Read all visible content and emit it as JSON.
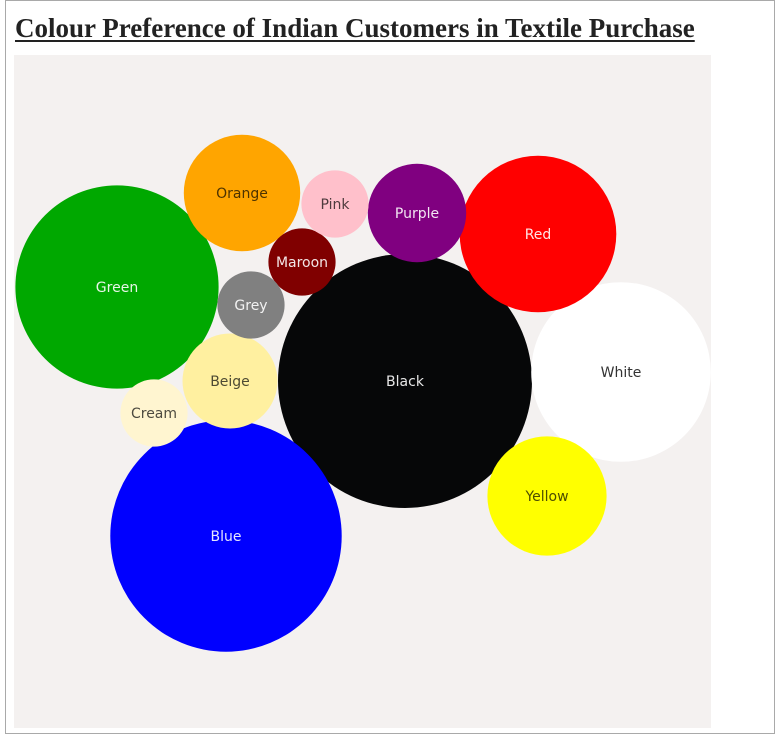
{
  "title": "Colour Preference of Indian Customers in Textile Purchase",
  "chart_data": {
    "type": "bubble",
    "title": "Colour Preference of Indian Customers in Textile Purchase",
    "bubbles": [
      {
        "label": "Black",
        "value": 100,
        "color": "#060708",
        "text_color": "#e6e6e6"
      },
      {
        "label": "Blue",
        "value": 83,
        "color": "#0000ff",
        "text_color": "#e6e6ff"
      },
      {
        "label": "Green",
        "value": 64,
        "color": "#00a800",
        "text_color": "#e8f5e8"
      },
      {
        "label": "White",
        "value": 50,
        "color": "#ffffff",
        "text_color": "#333333"
      },
      {
        "label": "Red",
        "value": 38,
        "color": "#ff0000",
        "text_color": "#ffe6e6"
      },
      {
        "label": "Orange",
        "value": 21,
        "color": "#ffa500",
        "text_color": "#4d3300"
      },
      {
        "label": "Yellow",
        "value": 22,
        "color": "#ffff00",
        "text_color": "#4d4d00"
      },
      {
        "label": "Purple",
        "value": 15,
        "color": "#800080",
        "text_color": "#f2e6f2"
      },
      {
        "label": "Beige",
        "value": 14,
        "color": "#fff0a0",
        "text_color": "#4d4a33"
      },
      {
        "label": "Maroon",
        "value": 7,
        "color": "#800000",
        "text_color": "#f2e6e6"
      },
      {
        "label": "Pink",
        "value": 7,
        "color": "#ffc0cb",
        "text_color": "#4d3a3d"
      },
      {
        "label": "Grey",
        "value": 7,
        "color": "#808080",
        "text_color": "#f2f2f2"
      },
      {
        "label": "Cream",
        "value": 7,
        "color": "#fff5d0",
        "text_color": "#4d4a3f"
      }
    ]
  }
}
